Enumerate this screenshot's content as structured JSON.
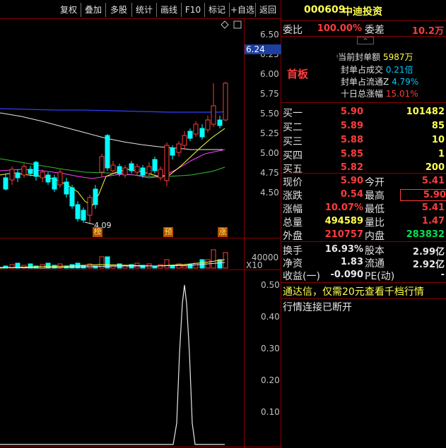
{
  "toolbar": {
    "buttons": [
      "复权",
      "叠加",
      "多股",
      "统计",
      "画线",
      "F10",
      "标记",
      "+自选",
      "返回"
    ]
  },
  "stock": {
    "code": "000609",
    "name": "中迪投资"
  },
  "price_axis": {
    "ticks": [
      "6.50",
      "6.25",
      "6.00",
      "5.75",
      "5.50",
      "5.25",
      "5.00",
      "4.75",
      "4.50"
    ],
    "current_tag": "6.24"
  },
  "volume_axis": {
    "tick": "40000",
    "unit": "X10"
  },
  "indicator_axis": {
    "ticks": [
      "0.50",
      "0.40",
      "0.30",
      "0.20",
      "0.10"
    ]
  },
  "chart_marks": {
    "low_label": "4.09",
    "tags": [
      "榜",
      "预",
      "涨"
    ]
  },
  "weibi": {
    "label": "委比",
    "value": "100.00%",
    "diff_label": "委差",
    "diff_value": "10.2万"
  },
  "limit_info": {
    "badge": "首板",
    "rows": [
      {
        "label": "当前封单额",
        "value": "5987万"
      },
      {
        "label": "封单占成交",
        "value": "0.21倍"
      },
      {
        "label": "封单占流通Z",
        "value": "4.79%"
      },
      {
        "label": "十日总涨幅",
        "value": "15.01%"
      }
    ]
  },
  "order_book": [
    {
      "label": "买一",
      "price": "5.90",
      "volume": "101482"
    },
    {
      "label": "买二",
      "price": "5.89",
      "volume": "85"
    },
    {
      "label": "买三",
      "price": "5.88",
      "volume": "10"
    },
    {
      "label": "买四",
      "price": "5.85",
      "volume": "1"
    },
    {
      "label": "买五",
      "price": "5.82",
      "volume": "200"
    }
  ],
  "quote": {
    "rows": [
      {
        "l1": "现价",
        "v1": "5.90",
        "l2": "今开",
        "v2": "5.41"
      },
      {
        "l1": "涨跌",
        "v1": "0.54",
        "l2": "最高",
        "v2": "5.90"
      },
      {
        "l1": "涨幅",
        "v1": "10.07%",
        "l2": "最低",
        "v2": "5.41"
      },
      {
        "l1": "总量",
        "v1": "494589",
        "l2": "量比",
        "v2": "1.47"
      },
      {
        "l1": "外盘",
        "v1": "210757",
        "l2": "内盘",
        "v2": "283832"
      }
    ]
  },
  "finance": {
    "rows": [
      {
        "l1": "换手",
        "v1": "16.93%",
        "l2": "股本",
        "v2": "2.99亿"
      },
      {
        "l1": "净资",
        "v1": "1.83",
        "l2": "流通",
        "v2": "2.92亿"
      },
      {
        "l1": "收益(一)",
        "v1": "-0.090",
        "l2": "PE(动)",
        "v2": "-"
      }
    ]
  },
  "promo": "通达信，仅需20元查看千档行情",
  "status": "行情连接已断开",
  "colors": {
    "up": "#ff3c3c",
    "down": "#00ffff",
    "panel_border": "#8b0000"
  }
}
